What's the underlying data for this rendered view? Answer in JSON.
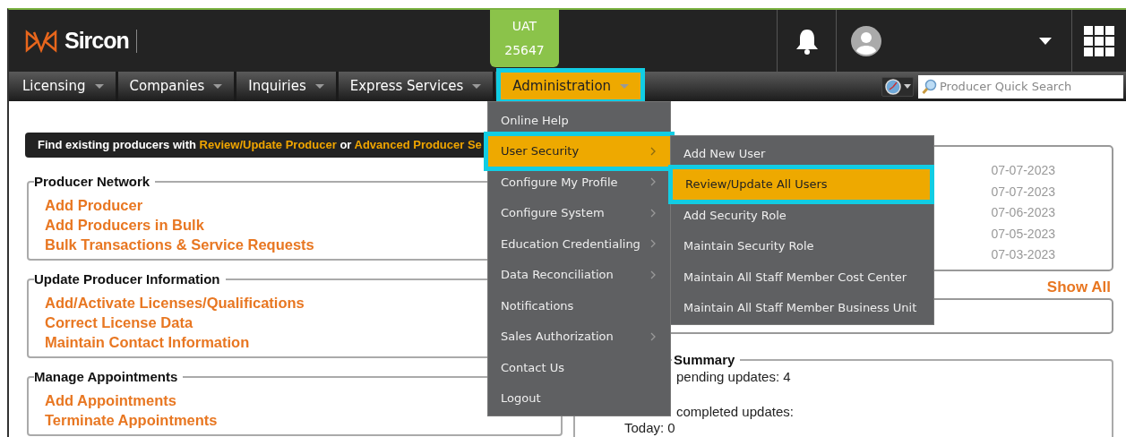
{
  "header": {
    "logo": "Sircon",
    "environment": [
      "UAT",
      "25647"
    ]
  },
  "nav": {
    "tabs": [
      {
        "label": "Licensing",
        "selected": false
      },
      {
        "label": "Companies",
        "selected": false
      },
      {
        "label": "Inquiries",
        "selected": false
      },
      {
        "label": "Express Services",
        "selected": false
      },
      {
        "label": "Administration",
        "selected": true
      }
    ],
    "search": {
      "placeholder": "Producer Quick Search"
    }
  },
  "banner": [
    {
      "kind": "text",
      "text": "Find existing producers with"
    },
    {
      "kind": "link",
      "text": "Review/Update Producer"
    },
    {
      "kind": "text",
      "text": "or"
    },
    {
      "kind": "link",
      "text": "Advanced Producer Se"
    }
  ],
  "sections": [
    {
      "title": "Producer Network",
      "links": [
        "Add Producer",
        "Add Producers in Bulk",
        "Bulk Transactions & Service Requests"
      ]
    },
    {
      "title": "Update Producer Information",
      "links": [
        "Add/Activate Licenses/Qualifications",
        "Correct License Data",
        "Maintain Contact Information"
      ]
    },
    {
      "title": "Manage Appointments",
      "links": [
        "Add Appointments",
        "Terminate Appointments"
      ]
    }
  ],
  "recent": {
    "dates": [
      "07-07-2023",
      "07-07-2023",
      "07-06-2023",
      "07-05-2023",
      "07-03-2023"
    ],
    "show_all": "Show All"
  },
  "summary": {
    "title": "Summary",
    "lines": [
      {
        "kind": "line",
        "text": "pending updates: 4"
      },
      {
        "kind": "gap-line",
        "text": "completed updates:"
      },
      {
        "kind": "indent",
        "text": "Today: 0"
      }
    ]
  },
  "admin_menu": {
    "items": [
      {
        "label": "Online Help",
        "submenu": false,
        "selected": false
      },
      {
        "label": "User Security",
        "submenu": true,
        "selected": true
      },
      {
        "label": "Configure My Profile",
        "submenu": true,
        "selected": false
      },
      {
        "label": "Configure System",
        "submenu": true,
        "selected": false
      },
      {
        "label": "Education Credentialing",
        "submenu": true,
        "selected": false
      },
      {
        "label": "Data Reconciliation",
        "submenu": true,
        "selected": false
      },
      {
        "label": "Notifications",
        "submenu": false,
        "selected": false
      },
      {
        "label": "Sales Authorization",
        "submenu": true,
        "selected": false
      },
      {
        "label": "Contact Us",
        "submenu": false,
        "selected": false
      },
      {
        "label": "Logout",
        "submenu": false,
        "selected": false
      }
    ]
  },
  "user_security_menu": {
    "items": [
      {
        "label": "Add New User",
        "selected": false
      },
      {
        "label": "Review/Update All Users",
        "selected": true
      },
      {
        "label": "Add Security Role",
        "selected": false
      },
      {
        "label": "Maintain Security Role",
        "selected": false
      },
      {
        "label": "Maintain All Staff Member Cost Center",
        "selected": false
      },
      {
        "label": "Maintain All Staff Member Business Unit",
        "selected": false
      }
    ]
  }
}
